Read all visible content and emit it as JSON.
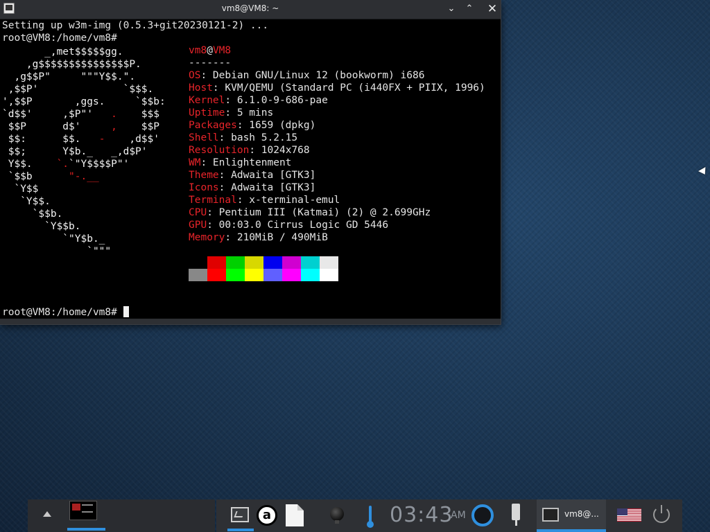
{
  "window": {
    "title": "vm8@VM8: ~",
    "controls": {
      "minimize": "⌄",
      "maximize": "⌃",
      "close": "✕"
    }
  },
  "terminal": {
    "setup_line": "Setting up w3m-img (0.5.3+git20230121-2) ...",
    "prompt_top": "root@VM8:/home/vm8#",
    "prompt_bottom": "root@VM8:/home/vm8# ",
    "neofetch": {
      "user": "vm8",
      "at": "@",
      "host": "VM8",
      "separator": "-------",
      "entries": [
        {
          "label": "OS",
          "value": ": Debian GNU/Linux 12 (bookworm) i686"
        },
        {
          "label": "Host",
          "value": ": KVM/QEMU (Standard PC (i440FX + PIIX, 1996)"
        },
        {
          "label": "Kernel",
          "value": ": 6.1.0-9-686-pae"
        },
        {
          "label": "Uptime",
          "value": ": 5 mins"
        },
        {
          "label": "Packages",
          "value": ": 1659 (dpkg)"
        },
        {
          "label": "Shell",
          "value": ": bash 5.2.15"
        },
        {
          "label": "Resolution",
          "value": ": 1024x768"
        },
        {
          "label": "WM",
          "value": ": Enlightenment"
        },
        {
          "label": "Theme",
          "value": ": Adwaita [GTK3]"
        },
        {
          "label": "Icons",
          "value": ": Adwaita [GTK3]"
        },
        {
          "label": "Terminal",
          "value": ": x-terminal-emul"
        },
        {
          "label": "CPU",
          "value": ": Pentium III (Katmai) (2) @ 2.699GHz"
        },
        {
          "label": "GPU",
          "value": ": 00:03.0 Cirrus Logic GD 5446"
        },
        {
          "label": "Memory",
          "value": ": 210MiB / 490MiB"
        }
      ],
      "palette_top": [
        "#000000",
        "#e00000",
        "#00d000",
        "#d8d800",
        "#0000f0",
        "#d000d0",
        "#00d0d0",
        "#e8e8e8"
      ],
      "palette_bottom": [
        "#888888",
        "#ff0000",
        "#00ff00",
        "#ffff00",
        "#6060ff",
        "#ff00ff",
        "#00ffff",
        "#ffffff"
      ]
    }
  },
  "taskbar": {
    "clock": "03:43",
    "ampm": "AM",
    "launcher_a": "a",
    "task_label": "vm8@..."
  },
  "colors": {
    "accent": "#2f8fde",
    "label_red": "#e8242a"
  },
  "icons": {
    "terminal_app": "terminal-icon",
    "browser": "a-icon",
    "files": "file-icon",
    "light": "bulb-icon",
    "thermometer": "thermometer-icon",
    "network": "ring-icon",
    "power_plug": "plug-icon",
    "keyboard_layout": "us-flag-icon",
    "shutdown": "power-icon"
  }
}
